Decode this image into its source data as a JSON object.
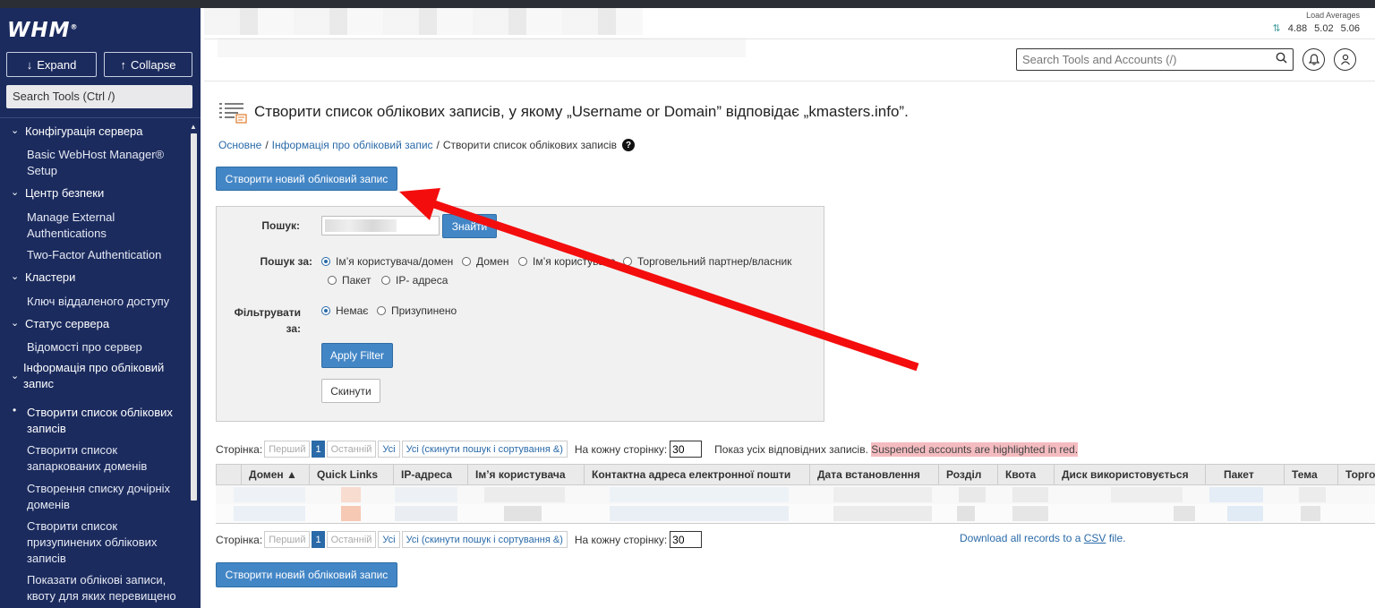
{
  "app": {
    "logo": "WHM",
    "logo_mark": "®"
  },
  "sidebar": {
    "expand_label": "Expand",
    "collapse_label": "Collapse",
    "search_placeholder": "Search Tools (Ctrl /)",
    "sections": [
      {
        "label": "Конфігурація сервера",
        "items": [
          "Basic WebHost Manager® Setup"
        ]
      },
      {
        "label": "Центр безпеки",
        "items": [
          "Manage External Authentications",
          "Two-Factor Authentication"
        ]
      },
      {
        "label": "Кластери",
        "items": [
          "Ключ віддаленого доступу"
        ]
      },
      {
        "label": "Статус сервера",
        "items": [
          "Відомості про сервер"
        ]
      },
      {
        "label": "Інформація про обліковий запис",
        "items": [
          "Створити список облікових записів",
          "Створити список запаркованих доменів",
          "Створення списку дочірніх доменів",
          "Створити список призупинених облікових записів",
          "Показати облікові записи, квоту для яких перевищено"
        ]
      }
    ]
  },
  "header": {
    "load_title": "Load Averages",
    "load_values": [
      "4.88",
      "5.02",
      "5.06"
    ],
    "search_placeholder": "Search Tools and Accounts (/)"
  },
  "main": {
    "title": "Створити список облікових записів, у якому „Username or Domain” відповідає „kmasters.info”.",
    "breadcrumbs": [
      "Основне",
      "Інформація про обліковий запис",
      "Створити список облікових записів"
    ],
    "create_button": "Створити новий обліковий запис",
    "filter": {
      "search_label": "Пошук:",
      "find_button": "Знайти",
      "search_by_label": "Пошук за:",
      "search_by_options": [
        "Ім’я користувача/домен",
        "Домен",
        "Ім’я користувача",
        "Торговельний партнер/власник",
        "Пакет",
        "IP- адреса"
      ],
      "filter_by_label": "Фільтрувати за:",
      "filter_by_options": [
        "Немає",
        "Призупинено"
      ],
      "apply_button": "Apply Filter",
      "reset_button": "Скинути"
    },
    "pager": {
      "page_label": "Сторінка:",
      "first": "Перший",
      "current": "1",
      "last": "Останній",
      "all": "Усі",
      "all_reset": "Усі (скинути пошук і сортування &)",
      "per_page_label": "На кожну сторінку:",
      "per_page_value": "30",
      "info": "Показ усіх відповідних записів.",
      "suspended_note": "Suspended accounts are highlighted in red."
    },
    "table": {
      "columns": [
        "Домен ▲",
        "Quick Links",
        "IP-адреса",
        "Ім’я користувача",
        "Контактна адреса електронної пошти",
        "Дата встановлення",
        "Розділ",
        "Квота",
        "Диск використовується",
        "Пакет",
        "Тема",
        "Торгов"
      ]
    },
    "download": {
      "prefix": "Download all records to a ",
      "link": "CSV",
      "suffix": " file."
    }
  }
}
